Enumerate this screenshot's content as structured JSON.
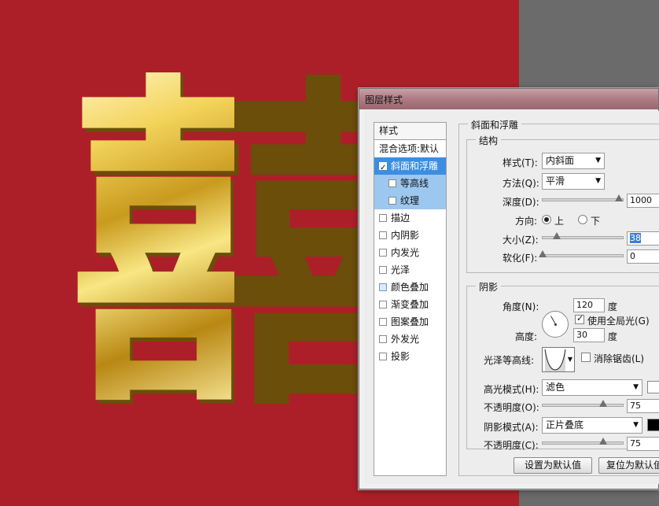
{
  "canvas": {
    "background": "#ad1f28",
    "glyph": "囍"
  },
  "dialog": {
    "title": "图层样式",
    "style_list": {
      "header": "样式",
      "blend_options": "混合选项:默认",
      "items": [
        {
          "label": "斜面和浮雕",
          "checked": true,
          "selected": true
        },
        {
          "label": "等高线",
          "checked": false,
          "sub": true
        },
        {
          "label": "纹理",
          "checked": false,
          "sub": true
        },
        {
          "label": "描边",
          "checked": false
        },
        {
          "label": "内阴影",
          "checked": false
        },
        {
          "label": "内发光",
          "checked": false
        },
        {
          "label": "光泽",
          "checked": false
        },
        {
          "label": "颜色叠加",
          "checked": false
        },
        {
          "label": "渐变叠加",
          "checked": false
        },
        {
          "label": "图案叠加",
          "checked": false
        },
        {
          "label": "外发光",
          "checked": false
        },
        {
          "label": "投影",
          "checked": false
        }
      ]
    },
    "bevel": {
      "section_title": "斜面和浮雕",
      "structure_title": "结构",
      "style_label": "样式(T):",
      "style_value": "内斜面",
      "technique_label": "方法(Q):",
      "technique_value": "平滑",
      "depth_label": "深度(D):",
      "depth_value": "1000",
      "depth_fraction": 0.95,
      "direction_label": "方向:",
      "direction_up": "上",
      "direction_down": "下",
      "size_label": "大小(Z):",
      "size_value": "38",
      "size_fraction": 0.18,
      "soften_label": "软化(F):",
      "soften_value": "0",
      "soften_fraction": 0.0
    },
    "shading": {
      "title": "阴影",
      "angle_label": "角度(N):",
      "angle_value": "120",
      "angle_unit": "度",
      "global_light_label": "使用全局光(G)",
      "altitude_label": "高度:",
      "altitude_value": "30",
      "altitude_unit": "度",
      "gloss_contour_label": "光泽等高线:",
      "anti_alias_label": "消除锯齿(L)",
      "highlight_mode_label": "高光模式(H):",
      "highlight_mode_value": "滤色",
      "highlight_opacity_label": "不透明度(O):",
      "highlight_opacity_value": "75",
      "highlight_opacity_fraction": 0.75,
      "shadow_mode_label": "阴影模式(A):",
      "shadow_mode_value": "正片叠底",
      "shadow_opacity_label": "不透明度(C):",
      "shadow_opacity_value": "75",
      "shadow_opacity_fraction": 0.75,
      "highlight_color": "#ffffff",
      "shadow_color": "#000000"
    },
    "buttons": {
      "make_default": "设置为默认值",
      "reset_default": "复位为默认值"
    }
  }
}
